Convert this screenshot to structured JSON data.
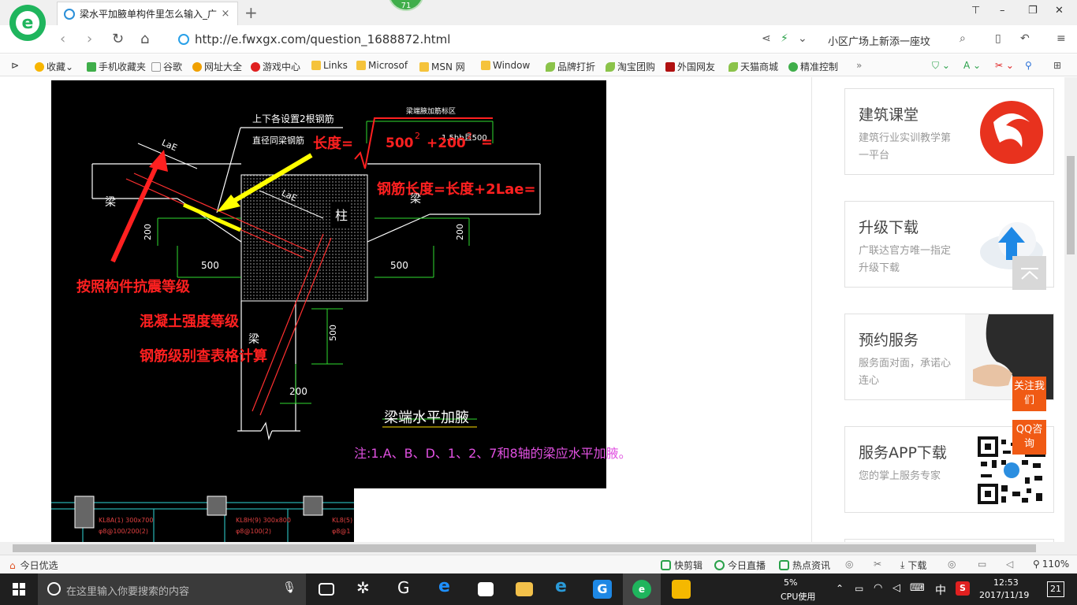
{
  "tab": {
    "title": "梁水平加腋单构件里怎么输入_广",
    "close": "×",
    "new": "+",
    "badge": "71"
  },
  "window": {
    "skin": "⊤",
    "min": "–",
    "max": "❐",
    "close": "✕"
  },
  "address": {
    "url": "http://e.fwxgx.com/question_1688872.html",
    "search_text": "小区广场上新添一座坟"
  },
  "bookmarks": [
    "收藏",
    "手机收藏夹",
    "谷歌",
    "网址大全",
    "游戏中心",
    "Links",
    "Microsof",
    "MSN 网",
    "Window",
    "品牌打折",
    "淘宝团购",
    "外国网友",
    "天猫商城",
    "精准控制"
  ],
  "cad": {
    "labels": {
      "length_formula": "长度=",
      "n500": "500",
      "sq1": "2",
      "n200": "+200",
      "sq2": "2",
      "eq": "=",
      "rebar_length": "钢筋长度=长度+2Lae=",
      "red1": "按照构件抗震等级",
      "red2": "混凝土强度等级",
      "red3": "钢筋级别查表格计算",
      "top_note1": "上下各设置2根钢筋",
      "top_note2": "直径同梁钢筋",
      "top_note3": "梁端腋加筋标区",
      "dim_top": "1.5hb且500",
      "lae1": "LaE",
      "lae2": "LaE",
      "beam_left": "梁",
      "beam_right": "梁",
      "beam_bottom": "梁",
      "column": "柱",
      "d200a": "200",
      "d500a": "500",
      "d500b": "500",
      "d200b": "200",
      "d500c": "500",
      "d200c": "200",
      "title": "梁端水平加腋",
      "note": "注:1.A、B、D、1、2、7和8轴的梁应水平加腋。",
      "small1": "KL8A(1) 300x700",
      "small2": "φ8@100/200(2)",
      "small3": "KL8H(9) 300x800",
      "small4": "φ8@100(2)",
      "small5": "KL8(5)",
      "small6": "φ8@1"
    }
  },
  "sidebar": [
    {
      "title": "建筑课堂",
      "desc": "建筑行业实训教学第一平台"
    },
    {
      "title": "升级下载",
      "desc": "广联达官方唯一指定升级下载"
    },
    {
      "title": "预约服务",
      "desc": "服务面对面，承诺心连心"
    },
    {
      "title": "服务APP下载",
      "desc": "您的掌上服务专家"
    }
  ],
  "float": {
    "follow": "关注我们",
    "qq": "QQ咨询"
  },
  "statusbar": {
    "left": "今日优选",
    "items": [
      "快剪辑",
      "今日直播",
      "热点资讯",
      "下载"
    ],
    "zoom": "110%"
  },
  "taskbar": {
    "search_placeholder": "在这里输入你要搜索的内容",
    "cpu_pct": "5%",
    "cpu_label": "CPU使用",
    "ime": "中",
    "time": "12:53",
    "date": "2017/11/19",
    "notif": "21"
  }
}
